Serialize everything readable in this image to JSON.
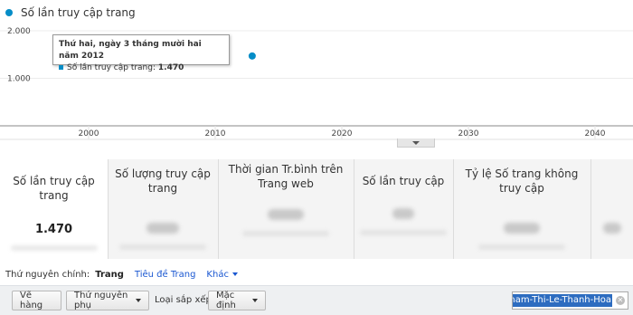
{
  "legend": {
    "label": "Số lần truy cập trang",
    "color": "#058dc7"
  },
  "chart_data": {
    "type": "scatter",
    "series": [
      {
        "name": "Số lần truy cập trang",
        "color": "#058dc7",
        "points": [
          {
            "x": 2012.92,
            "y": 1470
          }
        ]
      }
    ],
    "x_ticks": [
      "2000",
      "2010",
      "2020",
      "2030",
      "2040"
    ],
    "y_ticks": [
      "2.000",
      "1.000"
    ],
    "xlim": [
      1993,
      2043
    ],
    "ylim": [
      0,
      2000
    ],
    "grid": true
  },
  "tooltip": {
    "title": "Thứ hai, ngày 3 tháng mười hai năm 2012",
    "metric": "Số lần truy cập trang:",
    "value": "1.470"
  },
  "scorecards": [
    {
      "label": "Số lần truy cập trang",
      "value": "1.470"
    },
    {
      "label": "Số lượng truy cập trang"
    },
    {
      "label": "Thời gian Tr.bình trên Trang web"
    },
    {
      "label": "Số lần truy cập"
    },
    {
      "label": "Tỷ lệ Số trang không truy cập"
    }
  ],
  "dimension": {
    "label": "Thứ nguyên chính:",
    "active": "Trang",
    "option": "Tiêu đề Trang",
    "more": "Khác"
  },
  "toolbar": {
    "plot_rows": "Vẽ hàng",
    "secondary_dimension": "Thứ nguyên phụ",
    "sort_type_label": "Loại sắp xếp:",
    "sort_type_value": "Mặc định",
    "search_value": "Pham-Thi-Le-Thanh-Hoa",
    "clear_icon": "clear-icon"
  }
}
